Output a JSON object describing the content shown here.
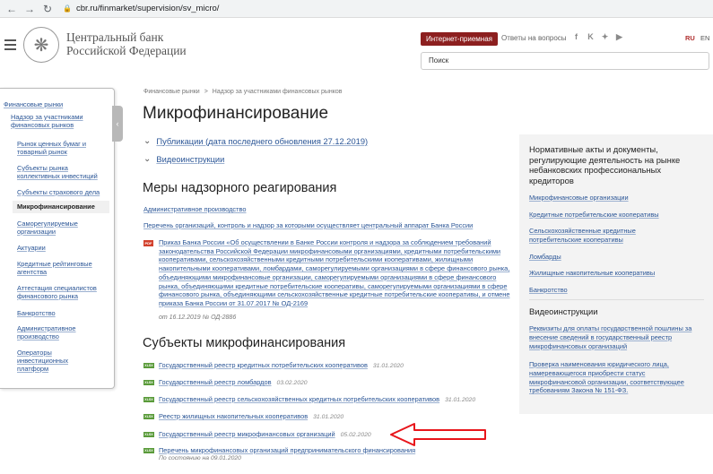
{
  "browser": {
    "url": "cbr.ru/finmarket/supervision/sv_micro/"
  },
  "header": {
    "bank_name_line1": "Центральный банк",
    "bank_name_line2": "Российской Федерации",
    "reception_label": "Интернет-приемная",
    "faq_label": "Ответы на вопросы",
    "social_icons": [
      "facebook-icon",
      "vk-icon",
      "twitter-icon",
      "youtube-icon"
    ],
    "lang_ru": "RU",
    "lang_en": "EN",
    "search_placeholder": "Поиск"
  },
  "sidebar": {
    "items": [
      "Финансовые рынки",
      "Надзор за участниками финансовых рынков",
      "Рынок ценных бумаг и товарный рынок",
      "Субъекты рынка коллективных инвестиций",
      "Субъекты страхового дела",
      "Микрофинансирование",
      "Саморегулируемые организации",
      "Актуарии",
      "Кредитные рейтинговые агентства",
      "Аттестация специалистов финансового рынка",
      "Банкротство",
      "Административное производство",
      "Операторы инвестиционных платформ"
    ]
  },
  "breadcrumb": {
    "item1": "Финансовые рынки",
    "sep": ">",
    "item2": "Надзор за участниками финансовых рынков"
  },
  "main": {
    "title": "Микрофинансирование",
    "accordion1": "Публикации (дата последнего обновления 27.12.2019)",
    "accordion2": "Видеоинструкции",
    "section1_title": "Меры надзорного реагирования",
    "link_admin": "Административное производство",
    "link_list": "Перечень организаций, контроль и надзор за которыми осуществляет центральный аппарат Банка России",
    "order_text": "Приказ Банка России «Об осуществлении в Банке России контроля и надзора за соблюдением требований законодательства Российской Федерации микрофинансовыми организациями, кредитными потребительскими кооперативами, сельскохозяйственными кредитными потребительскими кооперативами, жилищными накопительными кооперативами, ломбардами, саморегулируемыми организациями в сфере финансового рынка, объединяющими микрофинансовые организации, саморегулируемыми организациями в сфере финансового рынка, объединяющими кредитные потребительские кооперативы, саморегулируемыми организациями в сфере финансового рынка, объединяющими сельскохозяйственные кредитные потребительские кооперативы, и отмене приказа Банка России от 31.07.2017 № ОД-2169",
    "order_sub": "от 16.12.2019 № ОД-2886",
    "section2_title": "Субъекты микрофинансирования",
    "registries": [
      {
        "title": "Государственный реестр кредитных потребительских кооперативов",
        "date": "31.01.2020"
      },
      {
        "title": "Государственный реестр ломбардов",
        "date": "03.02.2020"
      },
      {
        "title": "Государственный реестр сельскохозяйственных кредитных потребительских кооперативов",
        "date": "31.01.2020"
      },
      {
        "title": "Реестр жилищных накопительных кооперативов",
        "date": "31.01.2020"
      },
      {
        "title": "Государственный реестр микрофинансовых организаций",
        "date": "05.02.2020"
      },
      {
        "title": "Перечень микрофинансовых организаций предпринимательского финансирования",
        "date": ""
      }
    ],
    "last_sub": "По состоянию на 09.01.2020",
    "file_badge": "XLSX",
    "pdf_badge": "PDF"
  },
  "right_panel": {
    "title1": "Нормативные акты и документы, регулирующие деятельность на рынке небанковских профессиональных кредиторов",
    "links1": [
      "Микрофинансовые организации",
      "Кредитные потребительские кооперативы",
      "Сельскохозяйственные кредитные потребительские кооперативы",
      "Ломбарды",
      "Жилищные накопительные кооперативы",
      "Банкротство"
    ],
    "title2": "Видеоинструкции",
    "links2": [
      "Реквизиты для оплаты государственной пошлины за внесение сведений в государственный реестр микрофинансовых организаций",
      "Проверка наименования юридического лица, намеревающегося приобрести статус микрофинансовой организации, соответствующее требованиям Закона № 151-ФЗ."
    ]
  },
  "annotation": {
    "arrow_color": "#e8151b"
  }
}
